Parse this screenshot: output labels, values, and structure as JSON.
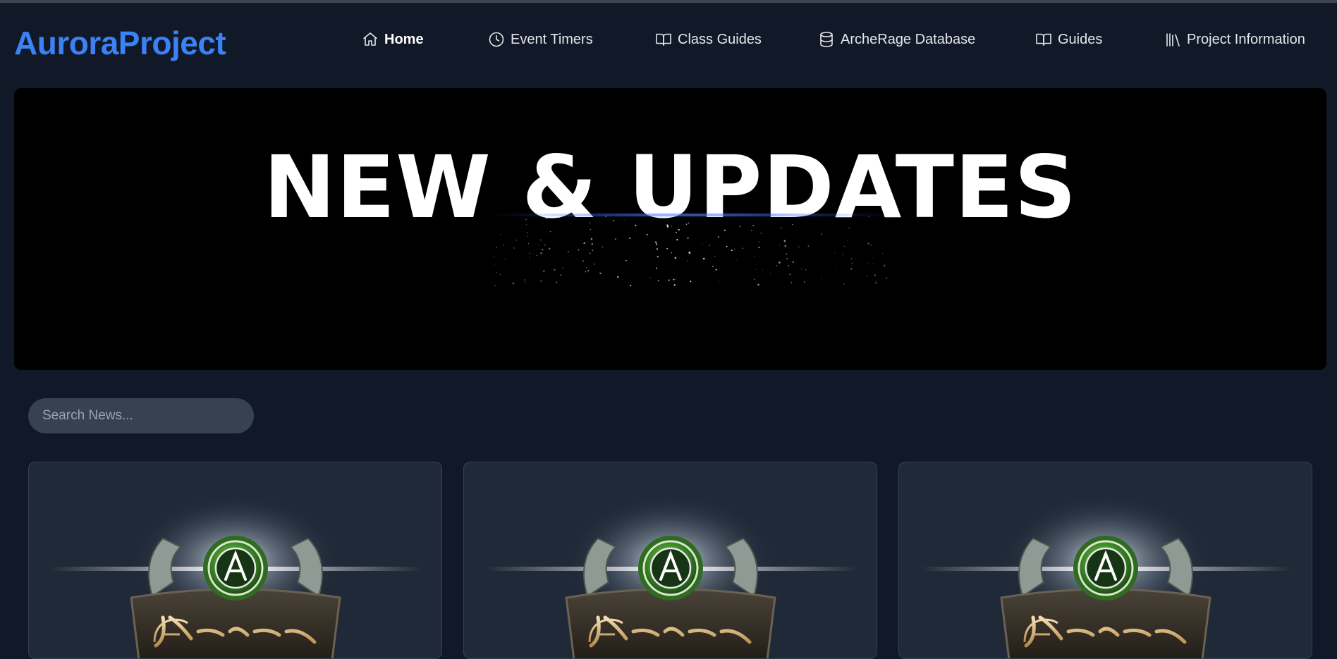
{
  "brand": "AuroraProject",
  "nav": {
    "items": [
      {
        "label": "Home",
        "icon": "home-icon"
      },
      {
        "label": "Event Timers",
        "icon": "clock-icon"
      },
      {
        "label": "Class Guides",
        "icon": "book-open-icon"
      },
      {
        "label": "ArcheRage Database",
        "icon": "database-icon"
      },
      {
        "label": "Guides",
        "icon": "book-open-icon"
      },
      {
        "label": "Project Information",
        "icon": "library-icon"
      }
    ],
    "active": "Home"
  },
  "hero": {
    "title": "NEW & UPDATES"
  },
  "search": {
    "placeholder": "Search News..."
  },
  "cards": [
    {
      "logo_text": "ArcheRage"
    },
    {
      "logo_text": "ArcheRage"
    },
    {
      "logo_text": "ArcheRage"
    }
  ],
  "colors": {
    "background": "#111827",
    "brand": "#3b82f6",
    "card": "#1f2937",
    "input": "#374151"
  }
}
